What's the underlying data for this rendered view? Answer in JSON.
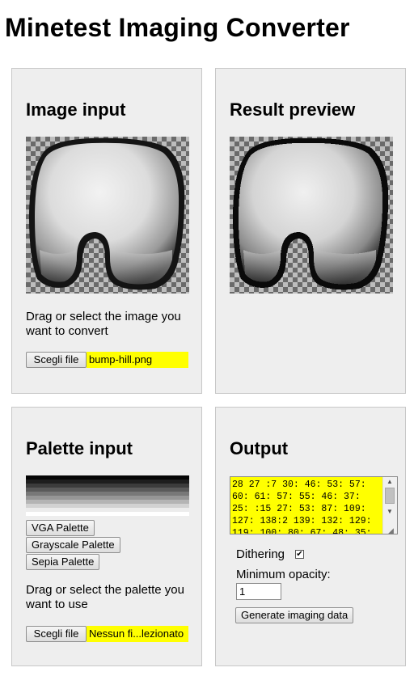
{
  "page": {
    "title": "Minetest Imaging Converter"
  },
  "image_input": {
    "heading": "Image input",
    "help": "Drag or select the image you want to convert",
    "file_button": "Scegli file",
    "file_name": "bump-hill.png"
  },
  "result_preview": {
    "heading": "Result preview"
  },
  "palette_input": {
    "heading": "Palette input",
    "palette_shades": [
      "#050505",
      "#1e1e1e",
      "#3c3c3c",
      "#5a5a5a",
      "#787878",
      "#969696",
      "#b4b4b4",
      "#d2d2d2",
      "#ececec",
      "#ffffff"
    ],
    "buttons": [
      "VGA Palette",
      "Grayscale Palette",
      "Sepia Palette"
    ],
    "help": "Drag or select the palette you want to use",
    "file_button": "Scegli file",
    "file_name": "Nessun fi...lezionato"
  },
  "output": {
    "heading": "Output",
    "data_text": "28 27 :7 30: 46: 53: 57: 60: 61: 57: 55: 46: 37: 25: :15 27: 53: 87: 109: 127: 138:2 139: 132: 129: 119: 100: 80: 67: 48: 35:",
    "dithering_label": "Dithering",
    "dithering_checked": true,
    "opacity_label": "Minimum opacity:",
    "opacity_value": "1",
    "generate_button": "Generate imaging data"
  }
}
